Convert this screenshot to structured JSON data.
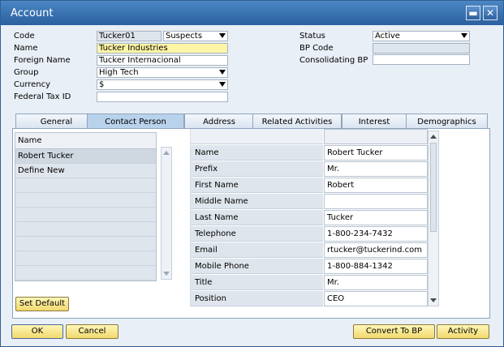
{
  "window": {
    "title": "Account"
  },
  "header": {
    "code": {
      "label": "Code",
      "value": "Tucker01",
      "type_value": "Suspects"
    },
    "name": {
      "label": "Name",
      "value": "Tucker Industries"
    },
    "foreign_name": {
      "label": "Foreign Name",
      "value": "Tucker Internacional"
    },
    "group": {
      "label": "Group",
      "value": "High Tech"
    },
    "currency": {
      "label": "Currency",
      "value": "$"
    },
    "federal_tax_id": {
      "label": "Federal Tax ID",
      "value": ""
    },
    "status": {
      "label": "Status",
      "value": "Active"
    },
    "bp_code": {
      "label": "BP Code",
      "value": ""
    },
    "consolidating_bp": {
      "label": "Consolidating BP",
      "value": ""
    }
  },
  "tabs": [
    {
      "label": "General"
    },
    {
      "label": "Contact Person"
    },
    {
      "label": "Address"
    },
    {
      "label": "Related Activities"
    },
    {
      "label": "Interest"
    },
    {
      "label": "Demographics"
    }
  ],
  "contacts": {
    "column_header": "Name",
    "rows": [
      "Robert Tucker",
      "Define New",
      "",
      "",
      "",
      "",
      "",
      "",
      ""
    ]
  },
  "details": [
    {
      "key": "Name",
      "value": "Robert Tucker"
    },
    {
      "key": "Prefix",
      "value": "Mr."
    },
    {
      "key": "First Name",
      "value": "Robert"
    },
    {
      "key": "Middle Name",
      "value": ""
    },
    {
      "key": "Last Name",
      "value": "Tucker"
    },
    {
      "key": "Telephone",
      "value": "1-800-234-7432"
    },
    {
      "key": "Email",
      "value": "rtucker@tuckerind.com"
    },
    {
      "key": "Mobile Phone",
      "value": "1-800-884-1342"
    },
    {
      "key": "Title",
      "value": "Mr."
    },
    {
      "key": "Position",
      "value": "CEO"
    }
  ],
  "buttons": {
    "set_default": "Set Default",
    "ok": "OK",
    "cancel": "Cancel",
    "convert_to_bp": "Convert To BP",
    "activity": "Activity"
  }
}
